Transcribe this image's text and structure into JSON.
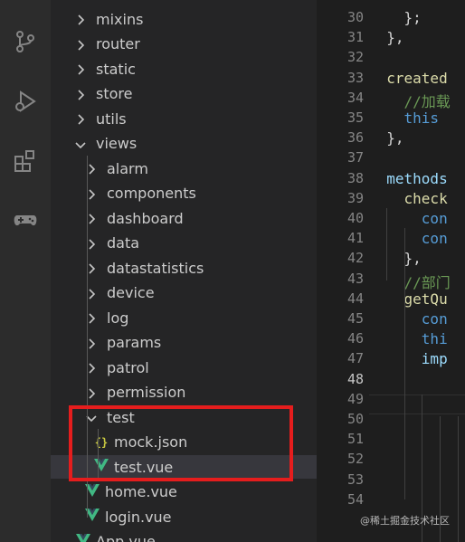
{
  "activity_bar": {
    "icons": [
      "source-control-icon",
      "run-debug-icon",
      "extensions-icon",
      "gamepad-icon"
    ]
  },
  "explorer": {
    "items": [
      {
        "label": "mixins",
        "type": "folder",
        "expanded": false,
        "depth": 1
      },
      {
        "label": "router",
        "type": "folder",
        "expanded": false,
        "depth": 1
      },
      {
        "label": "static",
        "type": "folder",
        "expanded": false,
        "depth": 1
      },
      {
        "label": "store",
        "type": "folder",
        "expanded": false,
        "depth": 1
      },
      {
        "label": "utils",
        "type": "folder",
        "expanded": false,
        "depth": 1
      },
      {
        "label": "views",
        "type": "folder",
        "expanded": true,
        "depth": 1
      },
      {
        "label": "alarm",
        "type": "folder",
        "expanded": false,
        "depth": 2
      },
      {
        "label": "components",
        "type": "folder",
        "expanded": false,
        "depth": 2
      },
      {
        "label": "dashboard",
        "type": "folder",
        "expanded": false,
        "depth": 2
      },
      {
        "label": "data",
        "type": "folder",
        "expanded": false,
        "depth": 2
      },
      {
        "label": "datastatistics",
        "type": "folder",
        "expanded": false,
        "depth": 2
      },
      {
        "label": "device",
        "type": "folder",
        "expanded": false,
        "depth": 2
      },
      {
        "label": "log",
        "type": "folder",
        "expanded": false,
        "depth": 2
      },
      {
        "label": "params",
        "type": "folder",
        "expanded": false,
        "depth": 2
      },
      {
        "label": "patrol",
        "type": "folder",
        "expanded": false,
        "depth": 2
      },
      {
        "label": "permission",
        "type": "folder",
        "expanded": false,
        "depth": 2
      },
      {
        "label": "test",
        "type": "folder",
        "expanded": true,
        "depth": 2
      },
      {
        "label": "mock.json",
        "type": "json",
        "depth": 3
      },
      {
        "label": "test.vue",
        "type": "vue",
        "depth": 3,
        "selected": true
      },
      {
        "label": "home.vue",
        "type": "vue",
        "depth": 2
      },
      {
        "label": "login.vue",
        "type": "vue",
        "depth": 2
      },
      {
        "label": "App.vue",
        "type": "vue",
        "depth": 1
      }
    ]
  },
  "editor": {
    "active_line": "48",
    "lines": [
      {
        "no": "30",
        "segments": [
          {
            "t": "    };",
            "c": "#d4d4d4"
          }
        ]
      },
      {
        "no": "31",
        "segments": [
          {
            "t": "  },",
            "c": "#d4d4d4"
          }
        ]
      },
      {
        "no": "32",
        "segments": []
      },
      {
        "no": "33",
        "segments": [
          {
            "t": "  created",
            "c": "#dcdcaa"
          }
        ]
      },
      {
        "no": "34",
        "segments": [
          {
            "t": "    //加载",
            "c": "#6a9955"
          }
        ]
      },
      {
        "no": "35",
        "segments": [
          {
            "t": "    this",
            "c": "#569cd6"
          }
        ]
      },
      {
        "no": "36",
        "segments": [
          {
            "t": "  },",
            "c": "#d4d4d4"
          }
        ]
      },
      {
        "no": "37",
        "segments": []
      },
      {
        "no": "38",
        "segments": [
          {
            "t": "  methods",
            "c": "#9cdcfe"
          }
        ]
      },
      {
        "no": "39",
        "segments": [
          {
            "t": "    check",
            "c": "#dcdcaa"
          }
        ]
      },
      {
        "no": "40",
        "segments": [
          {
            "t": "      con",
            "c": "#569cd6"
          }
        ]
      },
      {
        "no": "41",
        "segments": [
          {
            "t": "      con",
            "c": "#569cd6"
          }
        ]
      },
      {
        "no": "42",
        "segments": [
          {
            "t": "    },",
            "c": "#d4d4d4"
          }
        ]
      },
      {
        "no": "43",
        "segments": [
          {
            "t": "    //部门",
            "c": "#6a9955"
          }
        ]
      },
      {
        "no": "44",
        "segments": [
          {
            "t": "    getQu",
            "c": "#dcdcaa"
          }
        ]
      },
      {
        "no": "45",
        "segments": [
          {
            "t": "      con",
            "c": "#569cd6"
          }
        ]
      },
      {
        "no": "46",
        "segments": [
          {
            "t": "      thi",
            "c": "#569cd6"
          }
        ]
      },
      {
        "no": "47",
        "segments": [
          {
            "t": "      imp",
            "c": "#9cdcfe"
          }
        ]
      },
      {
        "no": "48",
        "segments": []
      },
      {
        "no": "49",
        "segments": []
      },
      {
        "no": "50",
        "segments": []
      },
      {
        "no": "51",
        "segments": []
      },
      {
        "no": "52",
        "segments": []
      },
      {
        "no": "53",
        "segments": []
      },
      {
        "no": "54",
        "segments": []
      }
    ]
  },
  "watermark": "@稀土掘金技术社区",
  "colors": {
    "highlight_border": "#e51d1d",
    "vue_icon": "#41b883",
    "json_icon": "#cbcb41"
  }
}
